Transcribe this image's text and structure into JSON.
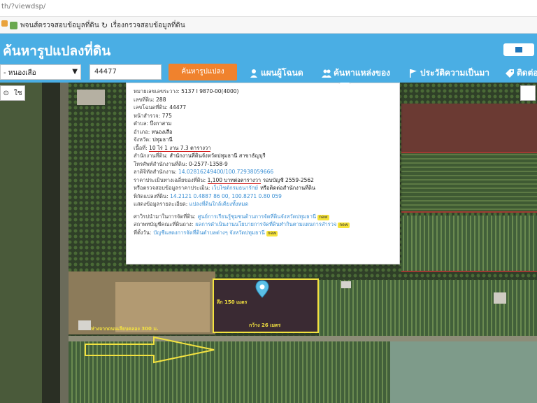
{
  "browser": {
    "url": "th/?viewdsp/",
    "bookmarks": [
      "พจนส์ตรวจสอบข้อมูลที่ดิน",
      "เรื่องกรวจสอบข้อมูลที่ดิน"
    ]
  },
  "app": {
    "title": "ค้นหารูปแปลงที่ดิน",
    "toolbar": {
      "district_value": "- หนองเสือ",
      "parcel_value": "44477",
      "search_label": "ค้นหารูปแปลง",
      "nav": [
        {
          "label": "แผนผู้โฉนด",
          "icon": "person-icon"
        },
        {
          "label": "ค้นหาแหล่งของ",
          "icon": "people-icon"
        },
        {
          "label": "ประวัติความเป็นมา",
          "icon": "flag-icon"
        },
        {
          "label": "ติดต่อ",
          "icon": "tag-icon"
        }
      ]
    },
    "map_controls": {
      "left": "⊙",
      "right": "ใช"
    }
  },
  "popup": {
    "rows": [
      {
        "label": "หมายเลขเลขระวาง:",
        "value": "5137 I 9870-00(4000)"
      },
      {
        "label": "เลขที่ดิน:",
        "value": "288"
      },
      {
        "label": "เลขโฉนดที่ดิน:",
        "value": "44477"
      },
      {
        "label": "หน้าสำรวจ:",
        "value": "775"
      },
      {
        "label": "ตำบล:",
        "value": "บึงกาสาม"
      },
      {
        "label": "อำเภอ:",
        "value": "หนองเสือ"
      },
      {
        "label": "จังหวัด:",
        "value": "ปทุมธานี"
      },
      {
        "label": "เนื้อที่:",
        "value": "10 ไร่ 1 งาน 7.3 ตารางวา",
        "underline": true
      },
      {
        "label": "สำนักงานที่ดิน:",
        "value": "สำนักงานที่ดินจังหวัดปทุมธานี สาขาธัญบุรี"
      },
      {
        "label": "โทรศัพท์สำนักงานที่ดิน:",
        "value": "0-2577-1358-9"
      },
      {
        "label": "ลาดิจิทัลสำนักงาน:",
        "value": "14.02816249400/100.72938059666",
        "link": true
      },
      {
        "label": "ราคาประเมินทางเฉลี่ยของที่ดิน:",
        "value": "1,100 บาทต่อตารางวา",
        "underline": true,
        "extra": "รอบบัญชี 2559-2562"
      },
      {
        "label": "หรือตรวจสอบข้อมูลราคาประเมิน:",
        "value": "เว็บไซต์กรมธนารักษ์",
        "link": true,
        "extra": "หรือติดต่อสำนักงานที่ดิน"
      },
      {
        "label": "พิกัดแปลงที่ดิน:",
        "value": "14.2121 0.4887 86 00, 100.8271 0.80 059",
        "link": true
      },
      {
        "label": "แสดงข้อมูลรายละเอียด:",
        "value": "แปลงที่ดินใกล้เคียงทั้งหมด",
        "link": true
      }
    ],
    "footer_rows": [
      {
        "label": "ศาวิรปนำมาในการจัดที่ดิน:",
        "value": "ศูนย์การเรียนรู้ชุมชนด้านการจัดที่ดินจังหวัดปทุมธานี",
        "tag": "new"
      },
      {
        "label": "สถาพทบัญชีคณะที่ดินถาง:",
        "value": "ผลการดำเนินงานนโยบายการจัดที่ดินทำกินตามแผนการสำรวจ",
        "tag": "new"
      },
      {
        "label": "ที่ตั้งวัน:",
        "value": "บัญชีแสดงการจัดที่ดินตำบลต่างๆ จังหวัดปทุมธานี",
        "tag": "new"
      }
    ]
  },
  "annotations": {
    "width_label": "ลึก 150 เมตร",
    "depth_label": "กว้าง 26 เมตร",
    "road_distance": "ห่างจากถนนเลียบคลอง 300 ม."
  }
}
